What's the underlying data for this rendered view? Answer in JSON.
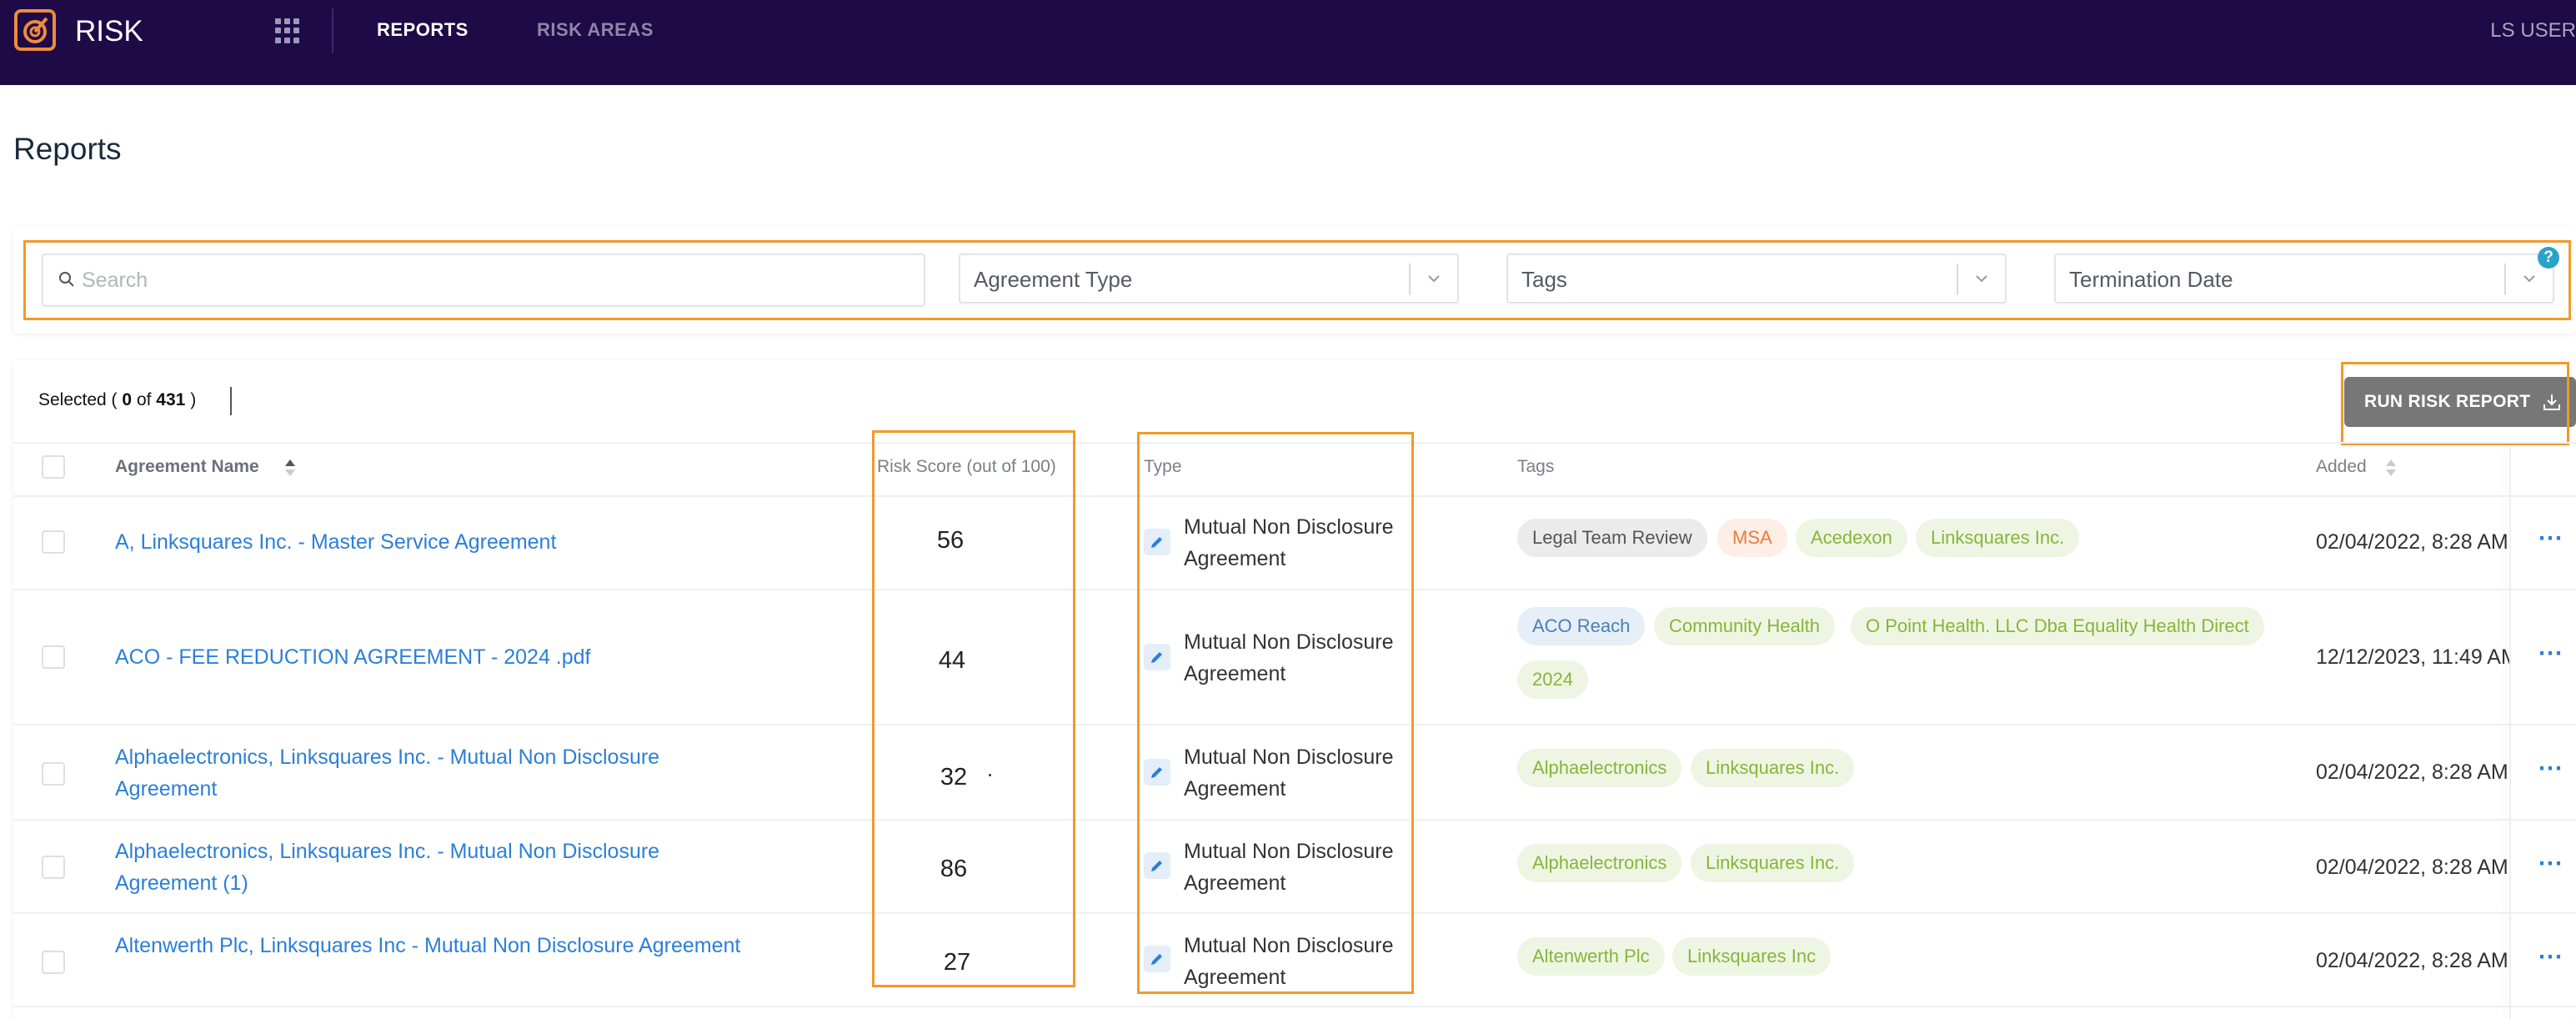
{
  "nav": {
    "app_name": "RISK",
    "links": [
      "REPORTS",
      "RISK AREAS"
    ],
    "user": "LS USER"
  },
  "page": {
    "title": "Reports"
  },
  "filters": {
    "search_placeholder": "Search",
    "agreement_type": "Agreement Type",
    "tags": "Tags",
    "termination_date": "Termination Date",
    "help": "?"
  },
  "selection": {
    "prefix": "Selected (",
    "count": "0",
    "of": "of",
    "total": "431",
    "suffix": ")"
  },
  "run_button": {
    "label": "RUN RISK REPORT"
  },
  "table": {
    "headers": {
      "name": "Agreement Name",
      "risk": "Risk Score (out of 100)",
      "type": "Type",
      "tags": "Tags",
      "added": "Added"
    },
    "rows": [
      {
        "name": "A, Linksquares Inc. - Master Service Agreement",
        "score": "56",
        "type": "Mutual Non Disclosure Agreement",
        "tags": [
          {
            "label": "Legal Team Review",
            "color": "gray"
          },
          {
            "label": "MSA",
            "color": "orange"
          },
          {
            "label": "Acedexon",
            "color": "green"
          },
          {
            "label": "Linksquares Inc.",
            "color": "green"
          }
        ],
        "added": "02/04/2022, 8:28 AM"
      },
      {
        "name": "ACO - FEE REDUCTION AGREEMENT - 2024 .pdf",
        "score": "44",
        "type": "Mutual Non Disclosure Agreement",
        "tags": [
          {
            "label": "ACO Reach",
            "color": "blue"
          },
          {
            "label": "Community Health",
            "color": "green"
          },
          {
            "label": "O Point Health. LLC Dba Equality Health Direct",
            "color": "green"
          },
          {
            "label": "2024",
            "color": "green"
          }
        ],
        "added": "12/12/2023, 11:49 AM"
      },
      {
        "name": "Alphaelectronics, Linksquares Inc. - Mutual Non Disclosure Agreement",
        "score": "32",
        "type": "Mutual Non Disclosure Agreement",
        "tags": [
          {
            "label": "Alphaelectronics",
            "color": "green"
          },
          {
            "label": "Linksquares Inc.",
            "color": "green"
          }
        ],
        "added": "02/04/2022, 8:28 AM"
      },
      {
        "name": "Alphaelectronics, Linksquares Inc. - Mutual Non Disclosure Agreement (1)",
        "score": "86",
        "type": "Mutual Non Disclosure Agreement",
        "tags": [
          {
            "label": "Alphaelectronics",
            "color": "green"
          },
          {
            "label": "Linksquares Inc.",
            "color": "green"
          }
        ],
        "added": "02/04/2022, 8:28 AM"
      },
      {
        "name": "Altenwerth Plc, Linksquares Inc - Mutual Non Disclosure Agreement",
        "score": "27",
        "type": "Mutual Non Disclosure Agreement",
        "tags": [
          {
            "label": "Altenwerth Plc",
            "color": "green"
          },
          {
            "label": "Linksquares Inc",
            "color": "green"
          }
        ],
        "added": "02/04/2022, 8:28 AM"
      }
    ],
    "more_label": "⋯"
  },
  "colors": {
    "nav_bg": "#1d0a47",
    "highlight": "#f09a2c",
    "link": "#2b7fd8",
    "run_button": "#777777"
  }
}
